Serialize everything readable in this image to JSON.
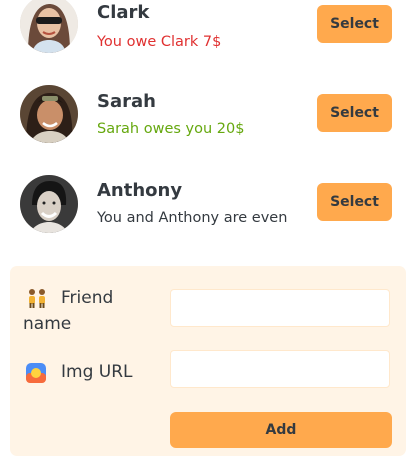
{
  "friends": [
    {
      "name": "Clark",
      "status": "You owe Clark 7$",
      "status_type": "negative",
      "button": "Select",
      "avatar_icon": "avatar-clark"
    },
    {
      "name": "Sarah",
      "status": "Sarah owes you 20$",
      "status_type": "positive",
      "button": "Select",
      "avatar_icon": "avatar-sarah"
    },
    {
      "name": "Anthony",
      "status": "You and Anthony are even",
      "status_type": "even",
      "button": "Select",
      "avatar_icon": "avatar-anthony"
    }
  ],
  "form": {
    "friend_name_label_line1": "Friend",
    "friend_name_label_line2": "name",
    "friend_name_icon": "two-people-icon",
    "img_url_label": "Img URL",
    "img_url_icon": "image-icon",
    "friend_name_value": "",
    "img_url_value": "",
    "add_button": "Add"
  },
  "colors": {
    "accent": "#ffa94d",
    "panel_bg": "#fff4e6",
    "negative": "#e03131",
    "positive": "#66a80f",
    "text": "#343a40"
  }
}
